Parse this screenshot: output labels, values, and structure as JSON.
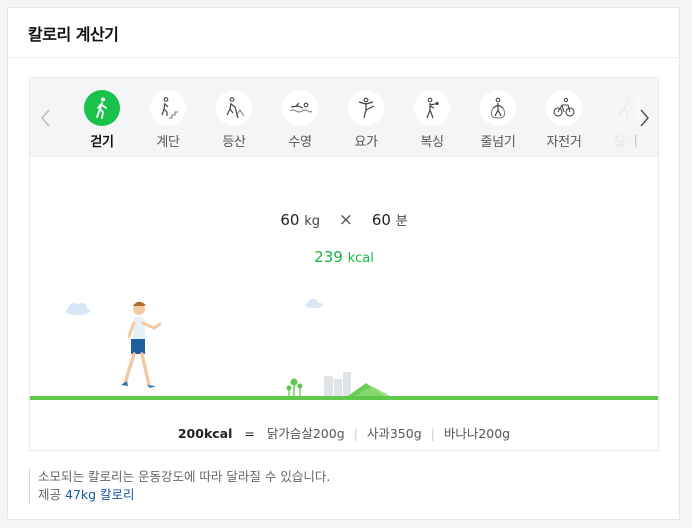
{
  "card": {
    "title": "칼로리 계산기"
  },
  "sports": [
    {
      "label": "걷기",
      "icon": "walking-icon",
      "active": true
    },
    {
      "label": "계단",
      "icon": "stairs-icon"
    },
    {
      "label": "등산",
      "icon": "hiking-icon"
    },
    {
      "label": "수영",
      "icon": "swimming-icon"
    },
    {
      "label": "요가",
      "icon": "yoga-icon"
    },
    {
      "label": "복싱",
      "icon": "boxing-icon"
    },
    {
      "label": "줄넘기",
      "icon": "jump-rope-icon"
    },
    {
      "label": "자전거",
      "icon": "bicycle-icon"
    },
    {
      "label": "달리",
      "icon": "running-icon"
    }
  ],
  "calc": {
    "weight": "60",
    "weight_unit": "kg",
    "times": "×",
    "minutes": "60",
    "minutes_unit": "분",
    "kcal": "239",
    "kcal_unit": "kcal"
  },
  "food": {
    "total": "200kcal",
    "eq": "=",
    "items": [
      "닭가슴살200g",
      "사과350g",
      "바나나200g"
    ],
    "sep": "|"
  },
  "footer": {
    "note": "소모되는 칼로리는 운동강도에 따라 달라질 수 있습니다.",
    "provider_prefix": "제공",
    "provider_name": "47kg 칼로리"
  },
  "colors": {
    "accent": "#19c24b",
    "ground": "#5fc84a",
    "link": "#1b58a8"
  }
}
